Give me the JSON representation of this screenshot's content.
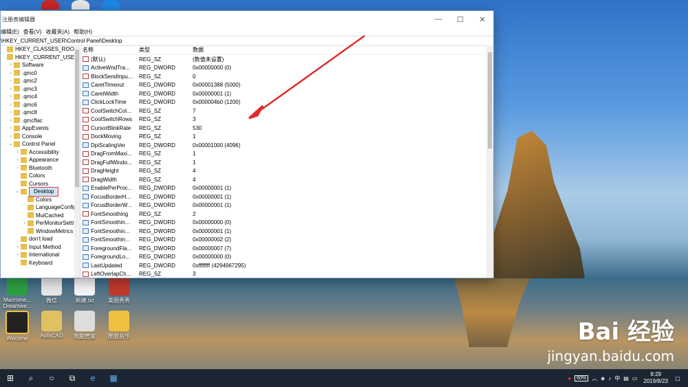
{
  "window": {
    "title": "注册表编辑器",
    "minimize": "—",
    "maximize": "☐",
    "close": "✕"
  },
  "menu": [
    "编辑(E)",
    "查看(V)",
    "收藏夹(A)",
    "帮助(H)"
  ],
  "address": "\\HKEY_CURRENT_USER\\Control Panel\\Desktop",
  "tree": [
    {
      "label": "HKEY_CLASSES_ROOT",
      "indent": 0,
      "exp": ""
    },
    {
      "label": "HKEY_CURRENT_USER",
      "indent": 0,
      "exp": ""
    },
    {
      "label": "Software",
      "indent": 1,
      "exp": ">"
    },
    {
      "label": ".qmc0",
      "indent": 1,
      "exp": ">"
    },
    {
      "label": ".qmc2",
      "indent": 1,
      "exp": ">"
    },
    {
      "label": ".qmc3",
      "indent": 1,
      "exp": ">"
    },
    {
      "label": ".qmc4",
      "indent": 1,
      "exp": ">"
    },
    {
      "label": ".qmc6",
      "indent": 1,
      "exp": ">"
    },
    {
      "label": ".qmc8",
      "indent": 1,
      "exp": ">"
    },
    {
      "label": ".qmcflac",
      "indent": 1,
      "exp": ">"
    },
    {
      "label": "AppEvents",
      "indent": 1,
      "exp": ">"
    },
    {
      "label": "Console",
      "indent": 1,
      "exp": ">"
    },
    {
      "label": "Control Panel",
      "indent": 1,
      "exp": "v"
    },
    {
      "label": "Accessibility",
      "indent": 2,
      "exp": ">"
    },
    {
      "label": "Appearance",
      "indent": 2,
      "exp": ">"
    },
    {
      "label": "Bluetooth",
      "indent": 2,
      "exp": ">"
    },
    {
      "label": "Colors",
      "indent": 2,
      "exp": ""
    },
    {
      "label": "Cursors",
      "indent": 2,
      "exp": ""
    },
    {
      "label": "Desktop",
      "indent": 2,
      "exp": "v",
      "selected": true
    },
    {
      "label": "Colors",
      "indent": 3,
      "exp": ""
    },
    {
      "label": "LanguageConfig",
      "indent": 3,
      "exp": ""
    },
    {
      "label": "MuiCached",
      "indent": 3,
      "exp": ""
    },
    {
      "label": "PerMonitorSetti",
      "indent": 3,
      "exp": ">"
    },
    {
      "label": "WindowMetrics",
      "indent": 3,
      "exp": ""
    },
    {
      "label": "don't load",
      "indent": 2,
      "exp": ""
    },
    {
      "label": "Input Method",
      "indent": 2,
      "exp": ">"
    },
    {
      "label": "International",
      "indent": 2,
      "exp": ">"
    },
    {
      "label": "Keyboard",
      "indent": 2,
      "exp": ""
    }
  ],
  "columns": {
    "name": "名称",
    "type": "类型",
    "data": "数据"
  },
  "values": [
    {
      "name": "(默认)",
      "type": "REG_SZ",
      "data": "(数值未设置)"
    },
    {
      "name": "ActiveWndTra...",
      "type": "REG_DWORD",
      "data": "0x00000000 (0)"
    },
    {
      "name": "BlockSendInpu...",
      "type": "REG_SZ",
      "data": "0"
    },
    {
      "name": "CaretTimeout",
      "type": "REG_DWORD",
      "data": "0x00001388 (5000)"
    },
    {
      "name": "CaretWidth",
      "type": "REG_DWORD",
      "data": "0x00000001 (1)"
    },
    {
      "name": "ClickLockTime",
      "type": "REG_DWORD",
      "data": "0x000004b0 (1200)"
    },
    {
      "name": "CoolSwitchCol...",
      "type": "REG_SZ",
      "data": "7"
    },
    {
      "name": "CoolSwitchRows",
      "type": "REG_SZ",
      "data": "3"
    },
    {
      "name": "CursorBlinkRate",
      "type": "REG_SZ",
      "data": "530"
    },
    {
      "name": "DockMoving",
      "type": "REG_SZ",
      "data": "1"
    },
    {
      "name": "DpiScalingVer",
      "type": "REG_DWORD",
      "data": "0x00001000 (4096)"
    },
    {
      "name": "DragFromMaxi...",
      "type": "REG_SZ",
      "data": "1"
    },
    {
      "name": "DragFullWindo...",
      "type": "REG_SZ",
      "data": "1"
    },
    {
      "name": "DragHeight",
      "type": "REG_SZ",
      "data": "4"
    },
    {
      "name": "DragWidth",
      "type": "REG_SZ",
      "data": "4"
    },
    {
      "name": "EnablePerProc...",
      "type": "REG_DWORD",
      "data": "0x00000001 (1)"
    },
    {
      "name": "FocusBorderH...",
      "type": "REG_DWORD",
      "data": "0x00000001 (1)"
    },
    {
      "name": "FocusBorderW...",
      "type": "REG_DWORD",
      "data": "0x00000001 (1)"
    },
    {
      "name": "FontSmoothing",
      "type": "REG_SZ",
      "data": "2"
    },
    {
      "name": "FontSmoothin...",
      "type": "REG_DWORD",
      "data": "0x00000000 (0)"
    },
    {
      "name": "FontSmoothin...",
      "type": "REG_DWORD",
      "data": "0x00000001 (1)"
    },
    {
      "name": "FontSmoothin...",
      "type": "REG_DWORD",
      "data": "0x00000002 (2)"
    },
    {
      "name": "ForegroundFla...",
      "type": "REG_DWORD",
      "data": "0x00000007 (7)"
    },
    {
      "name": "ForegroundLo...",
      "type": "REG_DWORD",
      "data": "0x00000000 (0)"
    },
    {
      "name": "LastUpdated",
      "type": "REG_DWORD",
      "data": "0xffffffff (4294967295)"
    },
    {
      "name": "LeftOverlapCh...",
      "type": "REG_SZ",
      "data": "3"
    }
  ],
  "desktop_icons": [
    {
      "label": "Macrome... Dreamwe...",
      "color": "#2ea043"
    },
    {
      "label": "微信",
      "color": "#ffffff"
    },
    {
      "label": "新建.txt",
      "color": "#ffffff"
    },
    {
      "label": "美图秀秀",
      "color": "#c0392b"
    },
    {
      "label": "Wecome",
      "color": "#222222"
    },
    {
      "label": "AutoCAD",
      "color": "#e0c060"
    },
    {
      "label": "电脑管家",
      "color": "#dddddd"
    },
    {
      "label": "酷我音乐",
      "color": "#f0c040"
    }
  ],
  "watermark": {
    "brand": "Bai 经验",
    "url": "jingyan.baidu.com"
  },
  "taskbar": {
    "battery": "60%",
    "ime": "中",
    "time": "8:29",
    "date": "2019/8/23"
  }
}
